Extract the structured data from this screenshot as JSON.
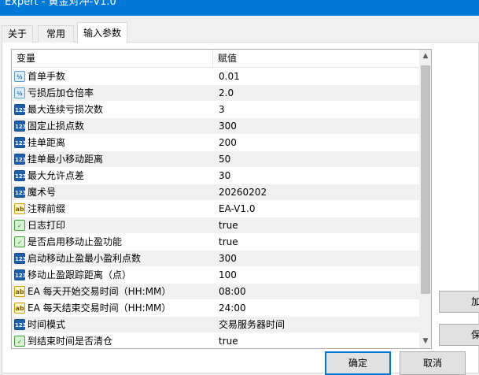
{
  "window": {
    "title": "Expert - 黄金对冲-V1.0"
  },
  "tabs": [
    {
      "label": "关于",
      "active": false
    },
    {
      "label": "常用",
      "active": false
    },
    {
      "label": "输入参数",
      "active": true
    }
  ],
  "grid": {
    "headers": {
      "variable": "变量",
      "value": "赋值"
    },
    "rows": [
      {
        "icon": "double-type-icon",
        "icon_text": "½",
        "name": "首单手数",
        "value": "0.01"
      },
      {
        "icon": "double-type-icon",
        "icon_text": "½",
        "name": "亏损后加仓倍率",
        "value": "2.0"
      },
      {
        "icon": "integer-type-icon",
        "icon_text": "123",
        "name": "最大连续亏损次数",
        "value": "3"
      },
      {
        "icon": "integer-type-icon",
        "icon_text": "123",
        "name": "固定止损点数",
        "value": "300"
      },
      {
        "icon": "integer-type-icon",
        "icon_text": "123",
        "name": "挂单距离",
        "value": "200"
      },
      {
        "icon": "integer-type-icon",
        "icon_text": "123",
        "name": "挂单最小移动距离",
        "value": "50"
      },
      {
        "icon": "integer-type-icon",
        "icon_text": "123",
        "name": "最大允许点差",
        "value": "30"
      },
      {
        "icon": "integer-type-icon",
        "icon_text": "123",
        "name": "魔术号",
        "value": "20260202"
      },
      {
        "icon": "string-type-icon",
        "icon_text": "ab",
        "name": "注释前缀",
        "value": "EA-V1.0"
      },
      {
        "icon": "bool-type-icon",
        "icon_text": "✓",
        "name": "日志打印",
        "value": "true"
      },
      {
        "icon": "bool-type-icon",
        "icon_text": "✓",
        "name": "是否启用移动止盈功能",
        "value": "true"
      },
      {
        "icon": "integer-type-icon",
        "icon_text": "123",
        "name": "启动移动止盈最小盈利点数",
        "value": "300"
      },
      {
        "icon": "integer-type-icon",
        "icon_text": "123",
        "name": "移动止盈跟踪距离（点）",
        "value": "100"
      },
      {
        "icon": "string-type-icon",
        "icon_text": "ab",
        "name": "EA 每天开始交易时间（HH:MM）",
        "value": "08:00"
      },
      {
        "icon": "string-type-icon",
        "icon_text": "ab",
        "name": "EA 每天结束交易时间（HH:MM）",
        "value": "24:00"
      },
      {
        "icon": "integer-type-icon",
        "icon_text": "123",
        "name": "时间模式",
        "value": "交易服务器时间"
      },
      {
        "icon": "bool-type-icon",
        "icon_text": "✓",
        "name": "到结束时间是否清仓",
        "value": "true"
      }
    ]
  },
  "side_buttons": {
    "load": "加",
    "save": "保"
  },
  "buttons": {
    "ok": "确定",
    "cancel": "取消"
  },
  "colors": {
    "titlebar": "#0078d7",
    "ok_border": "#0078d7"
  }
}
